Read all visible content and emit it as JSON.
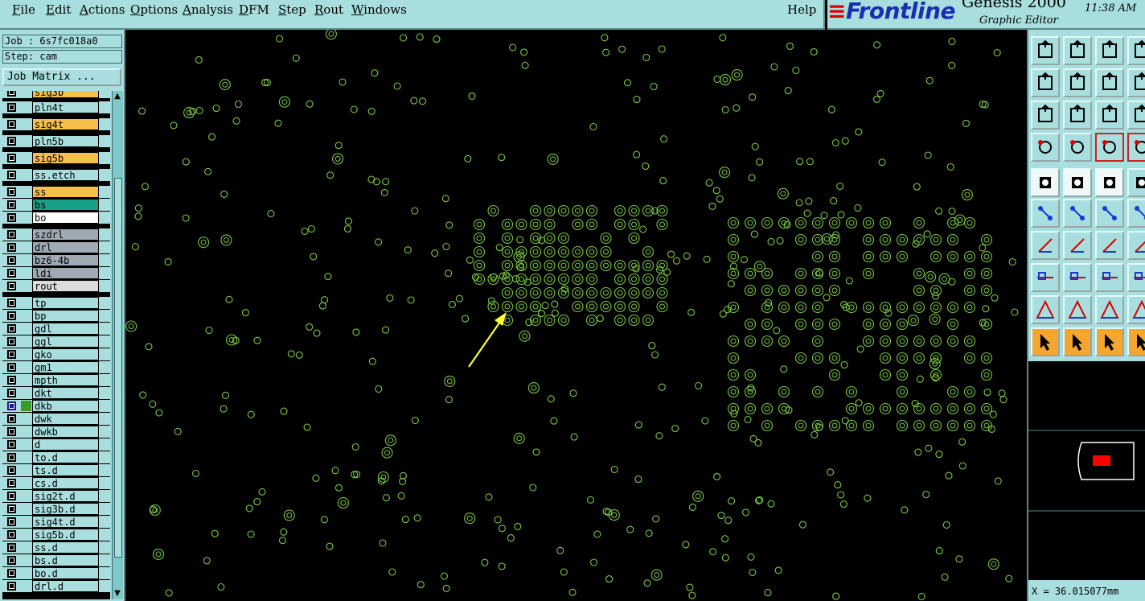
{
  "menu": {
    "items": [
      {
        "label": "File",
        "u": "F",
        "rest": "ile"
      },
      {
        "label": "Edit",
        "u": "E",
        "rest": "dit"
      },
      {
        "label": "Actions",
        "u": "A",
        "rest": "ctions"
      },
      {
        "label": "Options",
        "u": "O",
        "rest": "ptions"
      },
      {
        "label": "Analysis",
        "u": "A",
        "rest": "nalysis"
      },
      {
        "label": "DFM",
        "u": "D",
        "rest": "FM"
      },
      {
        "label": "Step",
        "u": "S",
        "rest": "tep"
      },
      {
        "label": "Rout",
        "u": "R",
        "rest": "out"
      },
      {
        "label": "Windows",
        "u": "W",
        "rest": "indows"
      }
    ],
    "help": "Help"
  },
  "brand": {
    "logo": "Frontline",
    "product": "Genesis 2000",
    "subtitle": "Graphic Editor",
    "time": "11:38 AM"
  },
  "job": {
    "job_label": "Job : 6s7fc018a0",
    "step_label": "Step: cam",
    "matrix_button": "Job Matrix ..."
  },
  "layers": [
    {
      "name": "sig3b",
      "color": "#f5c04a"
    },
    {
      "name": "pln4t",
      "color": "#a8dede"
    },
    {
      "name": "sig4t",
      "color": "#f5c04a"
    },
    {
      "name": "pln5b",
      "color": "#a8dede"
    },
    {
      "name": "sig5b",
      "color": "#f5c04a"
    },
    {
      "name": "ss.etch",
      "color": "#a8dede"
    },
    {
      "name": "ss",
      "color": "#f5c04a"
    },
    {
      "name": "bs",
      "color": "#16a085"
    },
    {
      "name": "bo",
      "color": "#ffffff"
    },
    {
      "name": "szdrl",
      "color": "#a0aab4"
    },
    {
      "name": "drl",
      "color": "#a0aab4"
    },
    {
      "name": "bz6-4b",
      "color": "#a0aab4"
    },
    {
      "name": "ldi",
      "color": "#a0aab4"
    },
    {
      "name": "rout",
      "color": "#dcdcdc"
    },
    {
      "name": "tp",
      "color": "#a8dede"
    },
    {
      "name": "bp",
      "color": "#a8dede"
    },
    {
      "name": "gdl",
      "color": "#a8dede"
    },
    {
      "name": "ggl",
      "color": "#a8dede"
    },
    {
      "name": "gko",
      "color": "#a8dede"
    },
    {
      "name": "gm1",
      "color": "#a8dede"
    },
    {
      "name": "mpth",
      "color": "#a8dede"
    },
    {
      "name": "dkt",
      "color": "#a8dede"
    },
    {
      "name": "dkb",
      "color": "#a8dede"
    },
    {
      "name": "dwk",
      "color": "#a8dede"
    },
    {
      "name": "dwkb",
      "color": "#a8dede"
    },
    {
      "name": "d",
      "color": "#a8dede"
    },
    {
      "name": "to.d",
      "color": "#a8dede"
    },
    {
      "name": "ts.d",
      "color": "#a8dede"
    },
    {
      "name": "cs.d",
      "color": "#a8dede"
    },
    {
      "name": "sig2t.d",
      "color": "#a8dede"
    },
    {
      "name": "sig3b.d",
      "color": "#a8dede"
    },
    {
      "name": "sig4t.d",
      "color": "#a8dede"
    },
    {
      "name": "sig5b.d",
      "color": "#a8dede"
    },
    {
      "name": "ss.d",
      "color": "#a8dede"
    },
    {
      "name": "bs.d",
      "color": "#a8dede"
    },
    {
      "name": "bo.d",
      "color": "#a8dede"
    },
    {
      "name": "drl.d",
      "color": "#a8dede"
    }
  ],
  "active_layer": "dkb",
  "canvas": {
    "pad_color": "#7ac943",
    "arrow_color": "#ffff33"
  },
  "coords": {
    "x": "X = 36.015077mm"
  }
}
